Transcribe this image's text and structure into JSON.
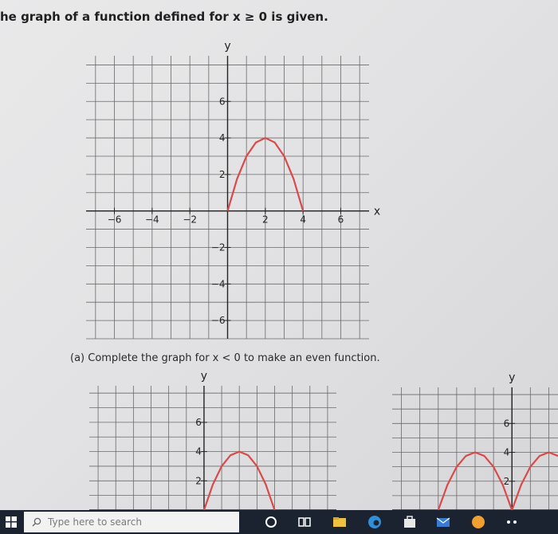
{
  "question": {
    "title": "he graph of a function defined for x ≥ 0 is given.",
    "part_a": "(a) Complete the graph for x < 0 to make an even function."
  },
  "colors": {
    "curve": "#d94a4a",
    "grid": "#6a6a6a",
    "axis": "#222222"
  },
  "chart_data": [
    {
      "type": "line",
      "xlabel": "x",
      "ylabel": "y",
      "xlim": [
        -7.5,
        7.5
      ],
      "ylim": [
        -7,
        8.5
      ],
      "grid": true,
      "x_ticks": [
        {
          "value": -6,
          "label": "−6"
        },
        {
          "value": -4,
          "label": "−4"
        },
        {
          "value": -2,
          "label": "−2"
        },
        {
          "value": 2,
          "label": "2"
        },
        {
          "value": 4,
          "label": "4"
        },
        {
          "value": 6,
          "label": "6"
        }
      ],
      "y_ticks": [
        {
          "value": 6,
          "label": "6"
        },
        {
          "value": 4,
          "label": "4"
        },
        {
          "value": 2,
          "label": "2"
        },
        {
          "value": -2,
          "label": "−2"
        },
        {
          "value": -4,
          "label": "−4"
        },
        {
          "value": -6,
          "label": "−6"
        }
      ],
      "series": [
        {
          "x": [
            0,
            0.5,
            1,
            1.5,
            2,
            2.5,
            3,
            3.5,
            4
          ],
          "y": [
            0,
            1.75,
            3,
            3.75,
            4,
            3.75,
            3,
            1.75,
            0
          ]
        }
      ]
    },
    {
      "type": "line",
      "ylabel": "y",
      "xlim": [
        -6.5,
        7.5
      ],
      "ylim": [
        0,
        8.5
      ],
      "grid": true,
      "y_ticks": [
        {
          "value": 6,
          "label": "6"
        },
        {
          "value": 4,
          "label": "4"
        },
        {
          "value": 2,
          "label": "2"
        }
      ],
      "series": [
        {
          "x": [
            0,
            0.5,
            1,
            1.5,
            2,
            2.5,
            3,
            3.5,
            4
          ],
          "y": [
            0,
            1.75,
            3,
            3.75,
            4,
            3.75,
            3,
            1.75,
            0
          ]
        }
      ]
    },
    {
      "type": "line",
      "ylabel": "y",
      "xlim": [
        -6.5,
        2.5
      ],
      "ylim": [
        0,
        8.5
      ],
      "grid": true,
      "y_ticks": [
        {
          "value": 6,
          "label": "6"
        },
        {
          "value": 4,
          "label": "4"
        },
        {
          "value": 2,
          "label": "2"
        }
      ],
      "series": [
        {
          "x": [
            -4,
            -3.5,
            -3,
            -2.5,
            -2,
            -1.5,
            -1,
            -0.5,
            0
          ],
          "y": [
            0,
            1.75,
            3,
            3.75,
            4,
            3.75,
            3,
            1.75,
            0
          ]
        },
        {
          "x": [
            0,
            0.5,
            1,
            1.5,
            2,
            2.5
          ],
          "y": [
            0,
            1.75,
            3,
            3.75,
            4,
            3.75
          ]
        }
      ]
    }
  ],
  "taskbar": {
    "search_placeholder": "Type here to search"
  }
}
